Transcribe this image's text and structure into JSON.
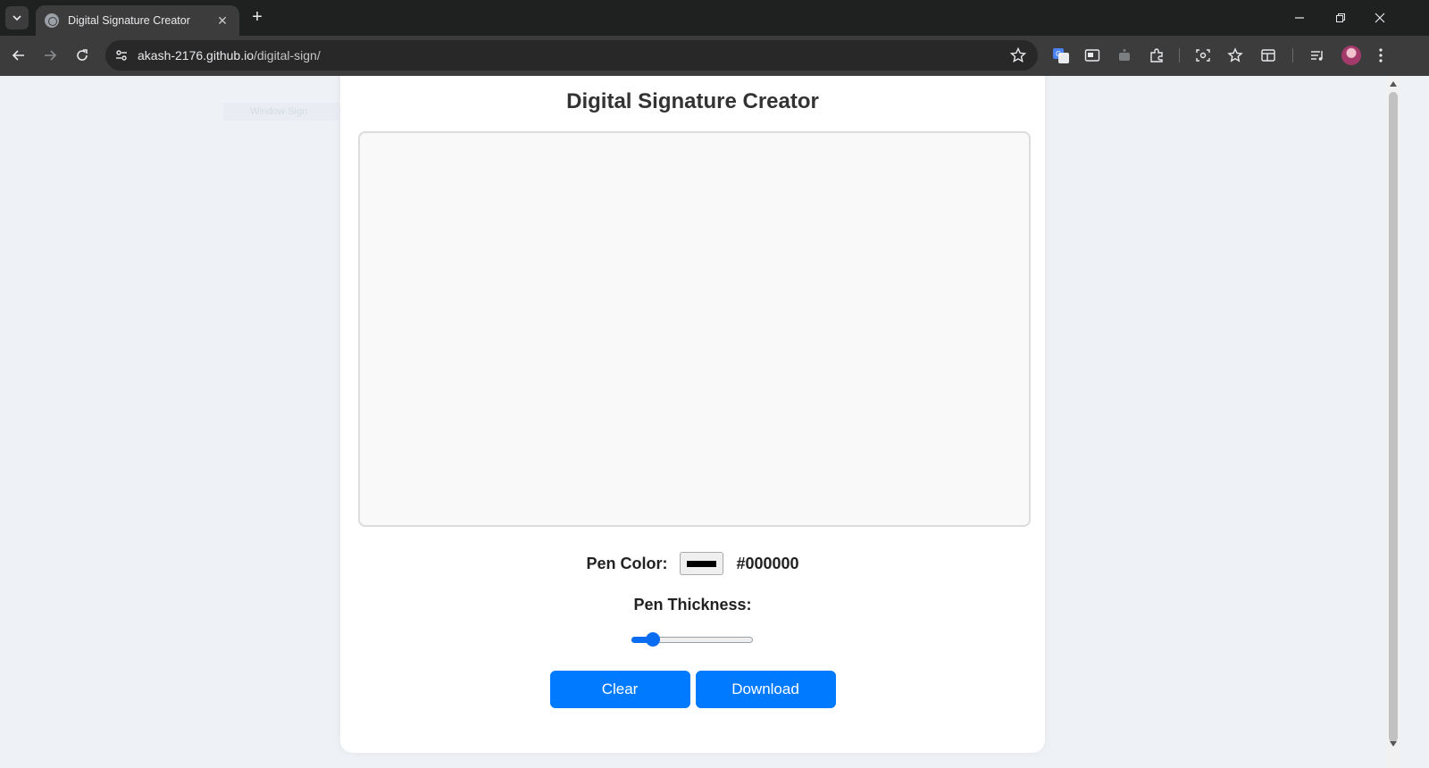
{
  "browser": {
    "tab_title": "Digital Signature Creator",
    "url_host": "akash-2176.github.io",
    "url_path": "/digital-sign/"
  },
  "page": {
    "ghost_label": "Window Sign",
    "title": "Digital Signature Creator",
    "pen_color_label": "Pen Color:",
    "pen_color_value": "#000000",
    "pen_thickness_label": "Pen Thickness:",
    "pen_thickness_level": 0.18,
    "clear_label": "Clear",
    "download_label": "Download"
  },
  "colors": {
    "accent": "#007bff",
    "title_text": "#333333",
    "canvas_bg": "#f9f9f9",
    "page_bg": "#eef1f5"
  }
}
